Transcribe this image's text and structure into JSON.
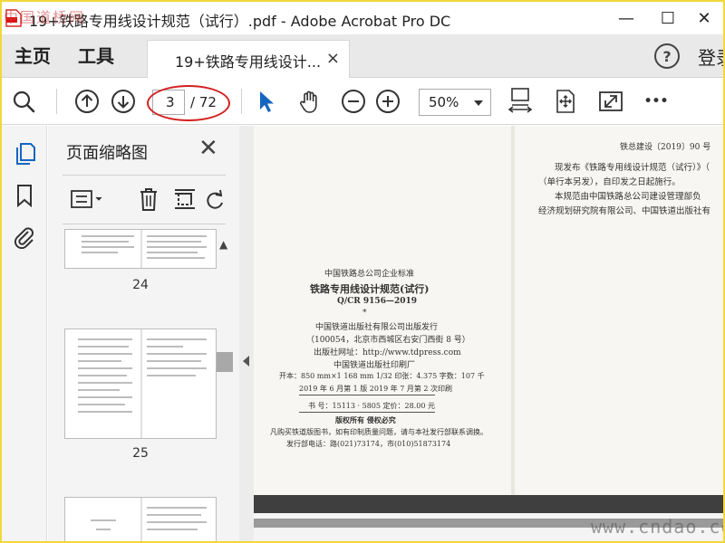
{
  "window": {
    "title": "19+铁路专用线设计规范（试行）.pdf - Adobe Acrobat Pro DC",
    "minimize": "—",
    "maximize": "☐",
    "close": "✕"
  },
  "watermark": {
    "top_left": "中国道桥网",
    "bottom_right": "www.cndao.com"
  },
  "tabs": {
    "home": "主页",
    "tools": "工具",
    "document": "19+铁路专用线设计...",
    "document_close": "×",
    "help": "?",
    "login": "登录"
  },
  "toolbar": {
    "page_current": "3",
    "page_total": "/ 72",
    "zoom": "50%",
    "more": "•••"
  },
  "thumbnails": {
    "title": "页面缩略图",
    "close": "✕",
    "pages": [
      {
        "label": "24"
      },
      {
        "label": "25"
      },
      {
        "label": ""
      }
    ]
  },
  "page": {
    "left": {
      "org": "中国铁路总公司企业标准",
      "title": "铁路专用线设计规范(试行)",
      "code": "Q/CR 9156—2019",
      "star": "*",
      "publisher": "中国铁道出版社有限公司出版发行",
      "address": "（100054，北京市西城区右安门西街 8 号）",
      "website": "出版社网址：http://www.tdpress.com",
      "printer": "中国铁道出版社印刷厂",
      "format": "开本：850 mm×1 168 mm   1/32   印张：4.375   字数：107 千",
      "edition": "2019 年 6 月第 1 版   2019 年 7 月第 2 次印刷",
      "isbn": "书   号：15113 · 5805         定价：28.00 元",
      "rights": "版权所有   侵权必究",
      "notice": "凡购买铁道版图书，如有印制质量问题，请与本社发行部联系调换。",
      "phone": "发行部电话：路(021)73174，市(010)51873174"
    },
    "right": {
      "doc_no": "铁总建设〔2019〕90 号",
      "line1": "现发布《铁路专用线设计规范（试行）》（",
      "line2": "（单行本另发），自印发之日起施行。",
      "line3": "本规范由中国铁路总公司建设管理部负",
      "line4": "经济规划研究院有限公司、中国铁道出版社有"
    }
  }
}
